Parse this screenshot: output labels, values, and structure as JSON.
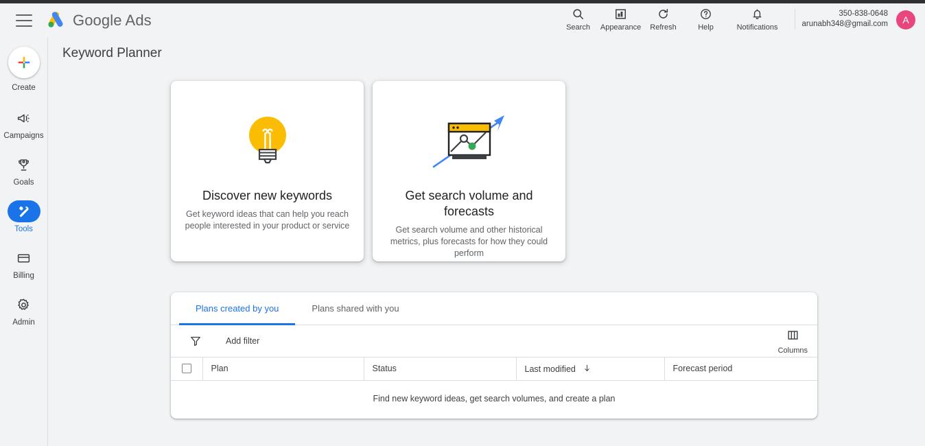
{
  "header": {
    "menu_icon": "hamburger-menu-icon",
    "brand_google": "Google",
    "brand_ads": "Ads",
    "actions": [
      {
        "label": "Search",
        "icon": "search-icon"
      },
      {
        "label": "Appearance",
        "icon": "appearance-icon"
      },
      {
        "label": "Refresh",
        "icon": "refresh-icon"
      },
      {
        "label": "Help",
        "icon": "help-icon"
      },
      {
        "label": "Notifications",
        "icon": "bell-icon"
      }
    ],
    "account_id": "350-838-0648",
    "account_email": "arunabh348@gmail.com",
    "avatar_initial": "A",
    "avatar_color": "#e8467c"
  },
  "sidebar": {
    "items": [
      {
        "label": "Create",
        "icon": "plus-icon",
        "active": false
      },
      {
        "label": "Campaigns",
        "icon": "megaphone-icon",
        "active": false
      },
      {
        "label": "Goals",
        "icon": "trophy-icon",
        "active": false
      },
      {
        "label": "Tools",
        "icon": "tools-icon",
        "active": true
      },
      {
        "label": "Billing",
        "icon": "credit-card-icon",
        "active": false
      },
      {
        "label": "Admin",
        "icon": "gear-icon",
        "active": false
      }
    ],
    "active_color": "#1a73e8"
  },
  "page": {
    "title": "Keyword Planner"
  },
  "cards": [
    {
      "title": "Discover new keywords",
      "description": "Get keyword ideas that can help you reach people interested in your product or service",
      "icon": "lightbulb-icon",
      "icon_color": "#fbbc04"
    },
    {
      "title": "Get search volume and forecasts",
      "description": "Get search volume and other historical metrics, plus forecasts for how they could perform",
      "icon": "forecast-chart-icon",
      "icon_color": "#fbbc04",
      "accent_color": "#4285f4"
    }
  ],
  "plans": {
    "tabs": [
      {
        "label": "Plans created by you",
        "active": true
      },
      {
        "label": "Plans shared with you",
        "active": false
      }
    ],
    "filter": {
      "icon": "filter-icon",
      "add_filter_label": "Add filter"
    },
    "columns_button": {
      "icon": "columns-icon",
      "label": "Columns"
    },
    "table": {
      "headers": [
        "Plan",
        "Status",
        "Last modified",
        "Forecast period"
      ],
      "sort_column": "Last modified",
      "sort_direction": "descending",
      "select_all_checkbox": false,
      "rows": [],
      "empty_message": "Find new keyword ideas, get search volumes, and create a plan"
    }
  }
}
